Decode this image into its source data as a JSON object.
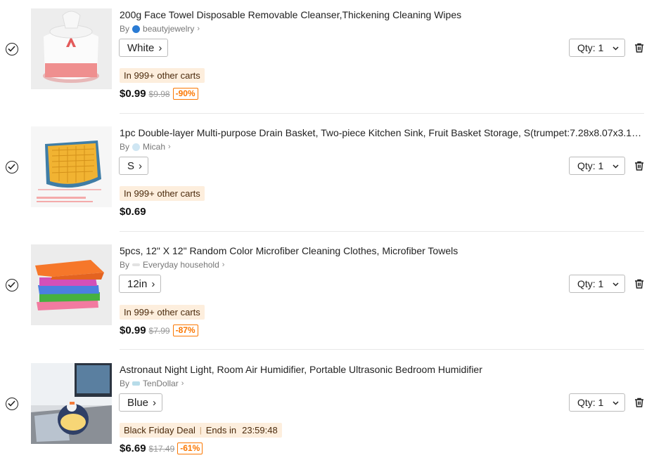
{
  "items": [
    {
      "title": "200g Face Towel Disposable Removable Cleanser,Thickening Cleaning Wipes",
      "by_label": "By",
      "seller": "beautyjewelry",
      "variant": "White",
      "badge": "In 999+ other carts",
      "price": "$0.99",
      "original_price": "$9.98",
      "discount": "-90%",
      "qty_label": "Qty: 1"
    },
    {
      "title": "1pc Double-layer Multi-purpose Drain Basket, Two-piece Kitchen Sink, Fruit Basket Storage, S(trumpet:7.28x8.07x3.14in) ,...",
      "by_label": "By",
      "seller": "Micah",
      "variant": "S",
      "badge": "In 999+ other carts",
      "price": "$0.69",
      "qty_label": "Qty: 1"
    },
    {
      "title": "5pcs, 12\" X 12\" Random Color Microfiber Cleaning Clothes, Microfiber Towels",
      "by_label": "By",
      "seller": "Everyday household",
      "variant": "12in",
      "badge": "In 999+ other carts",
      "price": "$0.99",
      "original_price": "$7.99",
      "discount": "-87%",
      "qty_label": "Qty: 1"
    },
    {
      "title": "Astronaut Night Light, Room Air Humidifier, Portable Ultrasonic Bedroom Humidifier",
      "by_label": "By",
      "seller": "TenDollar",
      "variant": "Blue",
      "badge_deal": "Black Friday Deal",
      "badge_sep": "|",
      "badge_ends": "Ends in",
      "badge_timer": "23:59:48",
      "price": "$6.69",
      "original_price": "$17.49",
      "discount": "-61%",
      "qty_label": "Qty: 1"
    }
  ],
  "colors": {
    "badge_bg": "#fdeedd",
    "discount": "#fb7701",
    "divider": "#e8e8e8"
  }
}
